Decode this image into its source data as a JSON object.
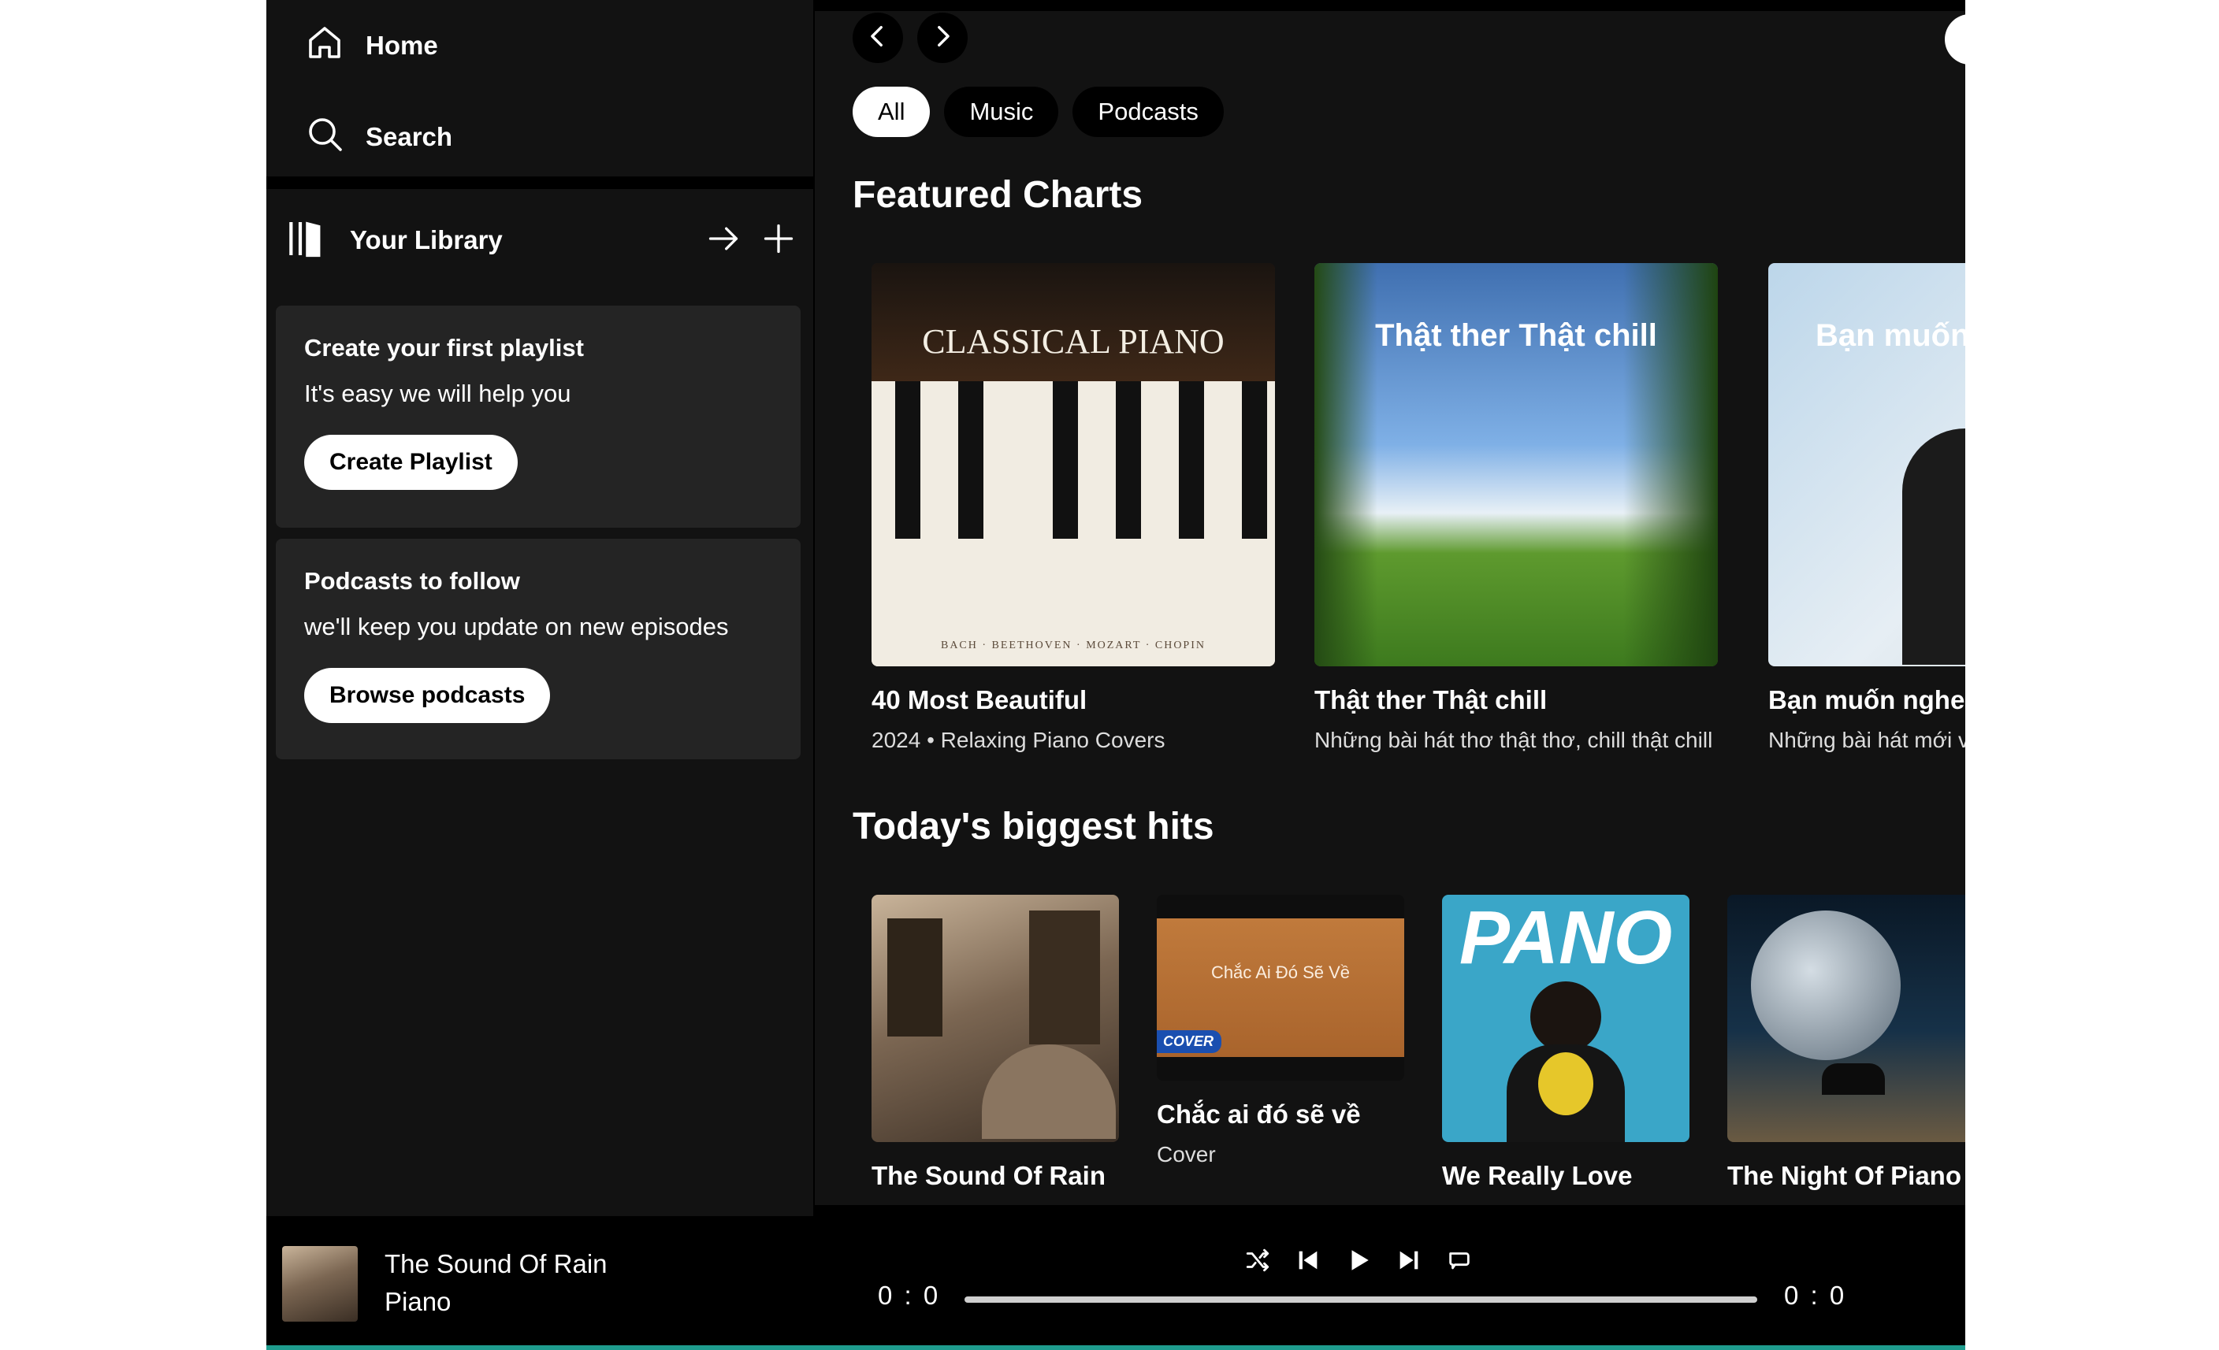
{
  "sidebar": {
    "nav": {
      "home_label": "Home",
      "search_label": "Search"
    },
    "library": {
      "title": "Your Library",
      "cards": [
        {
          "title": "Create your first playlist",
          "subtitle": "It's easy we will help you",
          "button": "Create Playlist"
        },
        {
          "title": "Podcasts to follow",
          "subtitle": "we'll keep you update on new episodes",
          "button": "Browse podcasts"
        }
      ]
    }
  },
  "main": {
    "filters": [
      "All",
      "Music",
      "Podcasts"
    ],
    "active_filter": "All",
    "featured": {
      "title": "Featured Charts",
      "items": [
        {
          "cover_text": "CLASSICAL PIANO",
          "cover_footer": "BACH · BEETHOVEN · MOZART · CHOPIN",
          "title": "40 Most Beautiful",
          "subtitle": "2024 • Relaxing Piano Covers"
        },
        {
          "cover_text": "Thật ther Thật chill",
          "title": "Thật ther Thật chill",
          "subtitle": "Những bài hát thơ thật thơ, chill thật chill"
        },
        {
          "cover_text": "Bạn muốn",
          "title": "Bạn muốn nghe",
          "subtitle": "Những bài hát mới v"
        }
      ]
    },
    "hits": {
      "title": "Today's biggest hits",
      "items": [
        {
          "title": "The Sound Of Rain",
          "subtitle": ""
        },
        {
          "cover_text": "Chắc Ai Đó Sẽ Về",
          "cover_badge": "COVER",
          "title": "Chắc ai đó sẽ về",
          "subtitle": "Cover"
        },
        {
          "cover_text": "PANO",
          "title": "We Really Love",
          "subtitle": ""
        },
        {
          "title": "The Night Of Piano",
          "subtitle": ""
        }
      ]
    }
  },
  "player": {
    "track_title": "The Sound Of Rain",
    "track_artist": "Piano",
    "time_current": "0 : 0",
    "time_total": "0 : 0",
    "progress": 0
  },
  "colors": {
    "accent": "#1f9c8e",
    "background": "#121212"
  }
}
